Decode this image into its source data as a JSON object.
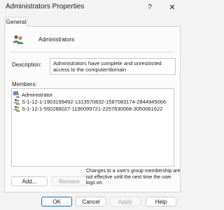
{
  "window": {
    "title": "Administrators Properties",
    "help_glyph": "?",
    "close_glyph": "✕"
  },
  "tabs": [
    {
      "label": "General"
    }
  ],
  "group": {
    "name": "Administrators",
    "icon": "group-icon"
  },
  "description": {
    "label": "Description:",
    "value": "Administrators have complete and unrestricted access to the computer/domain"
  },
  "members": {
    "label": "Members:",
    "items": [
      {
        "name": "Administrator",
        "icon": "user-icon"
      },
      {
        "name": "S-1-12-1-1903199492-1313570832-1587083174-2844945066",
        "icon": "group-icon"
      },
      {
        "name": "S-1-12-1-550288027-1190099721-2257830068-3050061622",
        "icon": "group-icon"
      }
    ]
  },
  "buttons": {
    "add": "Add...",
    "remove": "Remove",
    "ok": "OK",
    "cancel": "Cancel",
    "apply": "Apply",
    "help": "Help"
  },
  "note": "Changes to a user's group membership are not effective until the next time the user logs on.",
  "colors": {
    "accent": "#1f6fc0",
    "background": "#f3f3f3",
    "panel": "#fbfbfb"
  }
}
